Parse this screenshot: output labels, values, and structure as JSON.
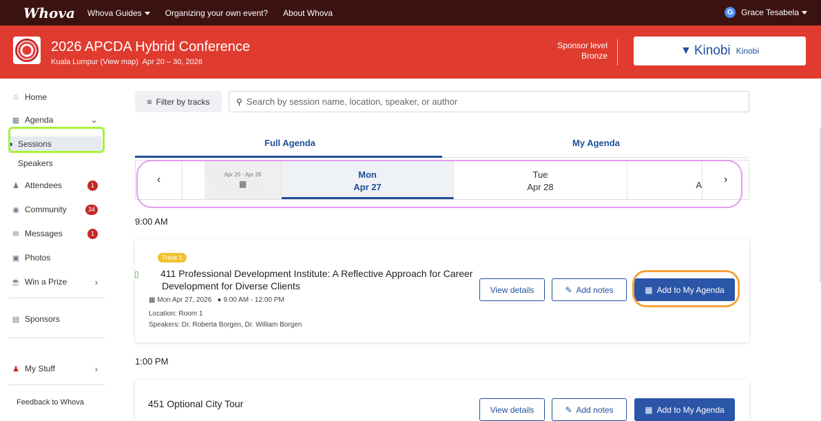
{
  "topnav": {
    "logo": "Whova",
    "links": [
      "Whova Guides",
      "Organizing your own event?",
      "About Whova"
    ],
    "user_initial": "G",
    "user_name": "Grace Tesabela"
  },
  "event": {
    "title": "2026 APCDA Hybrid Conference",
    "location": "Kuala Lumpur (View map)",
    "dates": "Apr 20 – 30, 2026",
    "sponsor_label_1": "Sponsor level",
    "sponsor_label_2": "Bronze",
    "sponsor_logo_text": "Kinobi",
    "sponsor_name": "Kinobi"
  },
  "sidebar": {
    "home": "Home",
    "agenda": "Agenda",
    "sessions": "Sessions",
    "speakers": "Speakers",
    "attendees": "Attendees",
    "attendees_badge": "1",
    "community": "Community",
    "community_badge": "34",
    "messages": "Messages",
    "messages_badge": "1",
    "photos": "Photos",
    "win_prize": "Win a Prize",
    "sponsors": "Sponsors",
    "my_stuff": "My Stuff",
    "feedback": "Feedback to Whova"
  },
  "toolbar": {
    "filter_label": "Filter by tracks",
    "search_placeholder": "Search by session name, location, speaker, or author"
  },
  "tabs": {
    "full": "Full Agenda",
    "mine": "My Agenda"
  },
  "days": {
    "past_range": "Apr 25 - Apr 26",
    "selected_dow": "Mon",
    "selected_date": "Apr 27",
    "next_dow": "Tue",
    "next_date": "Apr 28",
    "partial": "A"
  },
  "sessions": [
    {
      "time_heading": "9:00 AM",
      "track": "Track 1",
      "title": "411 Professional Development Institute: A Reflective Approach for Career Development for Diverse Clients",
      "date": "Mon Apr 27, 2026",
      "time": "9:00 AM - 12:00 PM",
      "location": "Location: Room 1",
      "speakers": "Speakers: Dr. Roberta Borgen, Dr. William Borgen"
    },
    {
      "time_heading": "1:00 PM",
      "title": "451 Optional City Tour"
    }
  ],
  "buttons": {
    "view_details": "View details",
    "add_notes": "Add notes",
    "add_agenda": "Add to My Agenda"
  },
  "colors": {
    "topnav": "#3a1210",
    "event_header": "#e03b2f",
    "accent": "#1f4e9b",
    "annotation_green": "#a6f23c",
    "annotation_purple": "#e39af0",
    "annotation_orange": "#f5a33a"
  }
}
